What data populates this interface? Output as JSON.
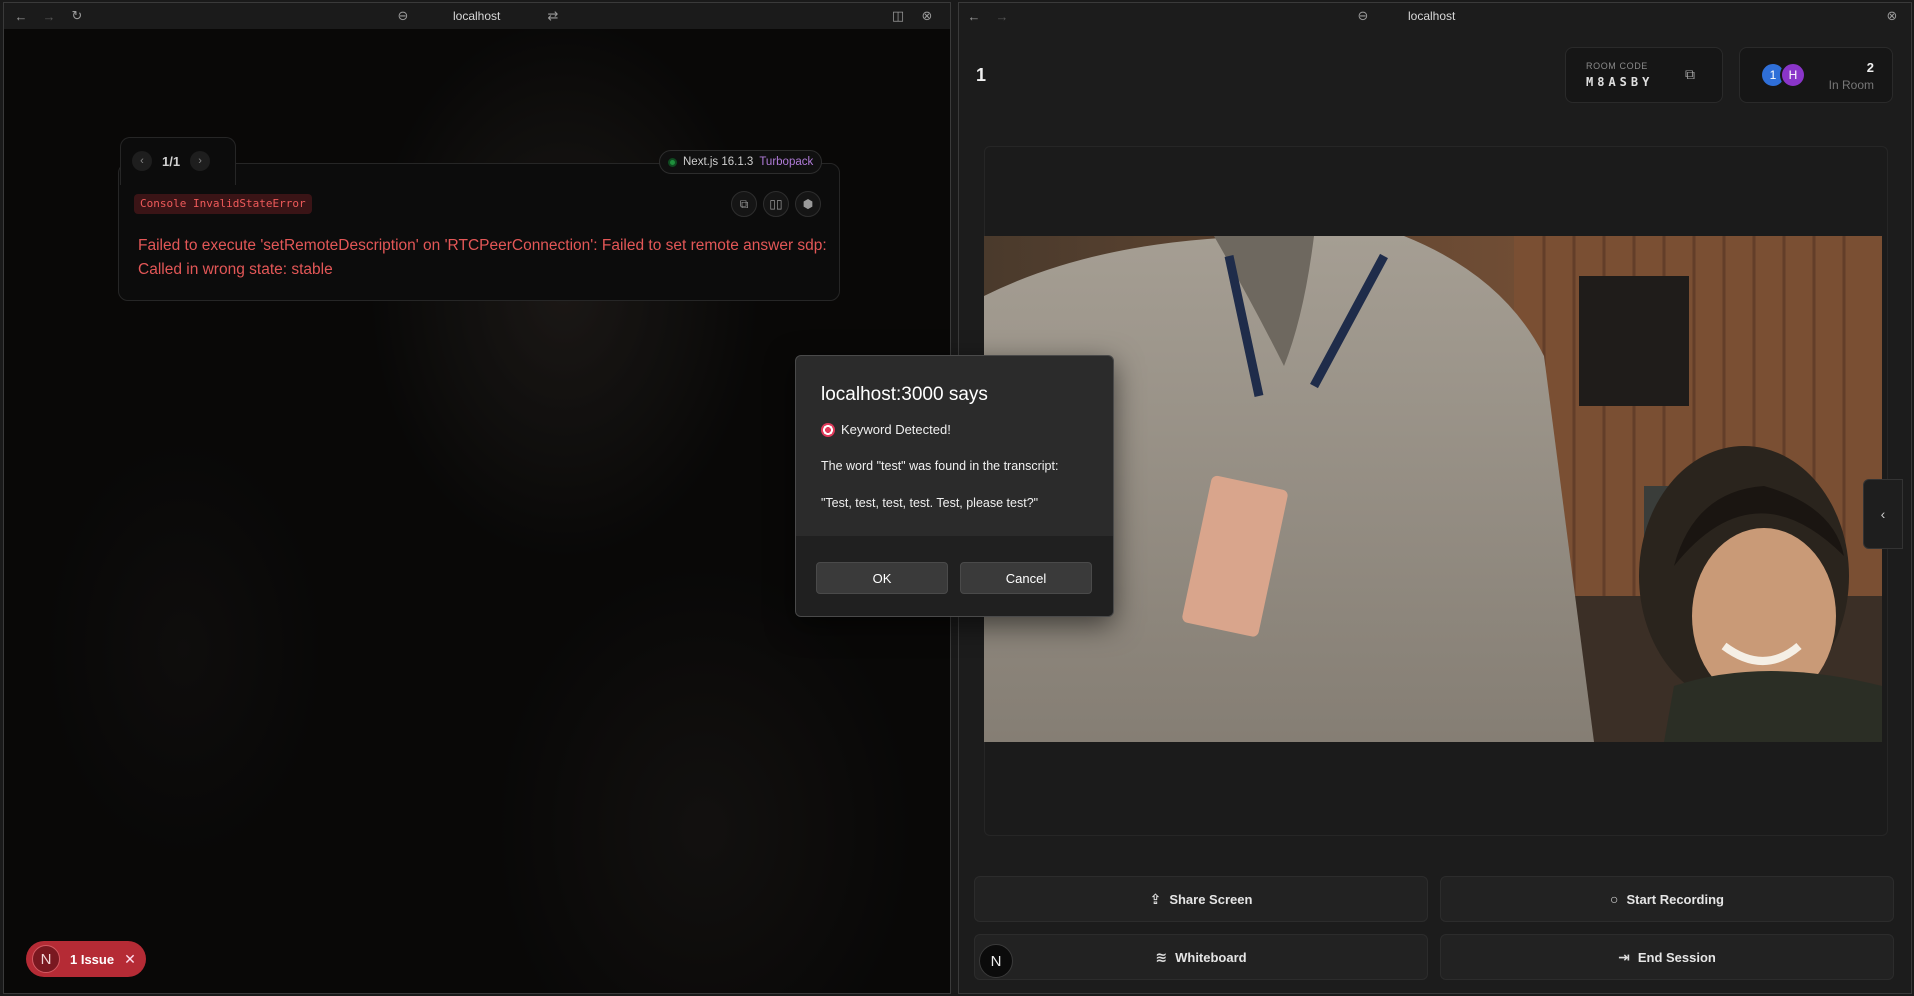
{
  "left_window": {
    "title": "localhost",
    "error_overlay": {
      "counter": "1/1",
      "version_label": "Next.js 16.1.3",
      "bundler": "Turbopack",
      "error_tag": "Console InvalidStateError",
      "message": "Failed to execute 'setRemoteDescription' on 'RTCPeerConnection': Failed to set remote answer sdp: Called in wrong state: stable"
    },
    "issue_badge": {
      "logo": "N",
      "label": "1 Issue"
    }
  },
  "right_window": {
    "title": "localhost",
    "room_number": "1",
    "room_code_label": "ROOM CODE",
    "room_code": "M8ASBY",
    "participants": {
      "avatars": [
        "1",
        "H"
      ],
      "count": "2",
      "label": "In Room"
    },
    "controls": {
      "share_screen": "Share Screen",
      "start_recording": "Start Recording",
      "whiteboard": "Whiteboard",
      "end_session": "End Session",
      "logo": "N"
    }
  },
  "dialog": {
    "title": "localhost:3000 says",
    "line1": "Keyword Detected!",
    "line2": "The word \"test\" was found in the transcript:",
    "line3": "\"Test, test, test, test. Test, please test?\"",
    "ok": "OK",
    "cancel": "Cancel"
  },
  "colors": {
    "error_red": "#e35757",
    "issue_pill": "#b52b35",
    "avatar_1": "#2f6fd8",
    "avatar_2": "#8a35c9"
  }
}
